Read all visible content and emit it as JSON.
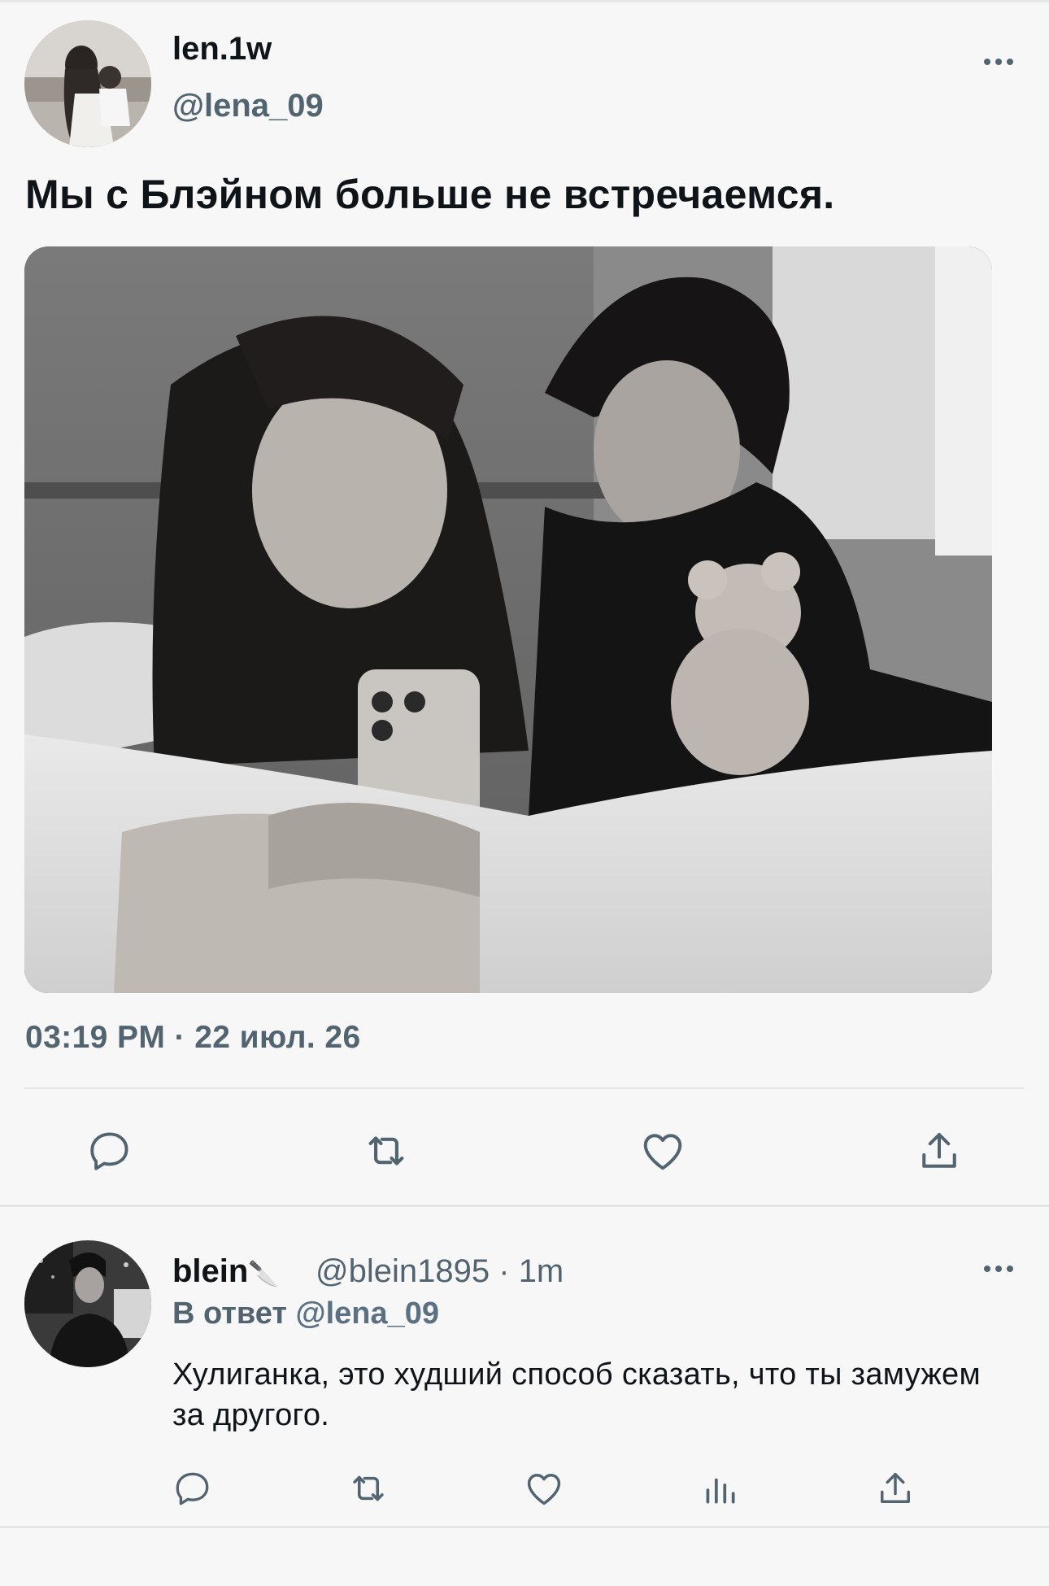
{
  "tweet": {
    "author_name": "len.1w",
    "author_handle": "@lena_09",
    "text": "Мы с Блэйном больше не встречаемся.",
    "time": "03:19 PM",
    "separator": "·",
    "date": "22 июл. 26",
    "actions": [
      "reply",
      "retweet",
      "like",
      "share"
    ]
  },
  "reply": {
    "author_name": "blein",
    "author_emoji": "🔪",
    "author_handle": "@blein1895",
    "dot": "·",
    "time_ago": "1m",
    "reply_prefix": "В ответ",
    "reply_mention": "@lena_09",
    "text": "Хулиганка, это худший способ сказать, что ты замужем за другого.",
    "actions": [
      "reply",
      "retweet",
      "like",
      "views",
      "share"
    ]
  },
  "colors": {
    "background": "#f7f7f7",
    "text": "#0f1419",
    "secondary": "#536471",
    "mention": "#5b7083",
    "divider": "#e4e4e4"
  }
}
